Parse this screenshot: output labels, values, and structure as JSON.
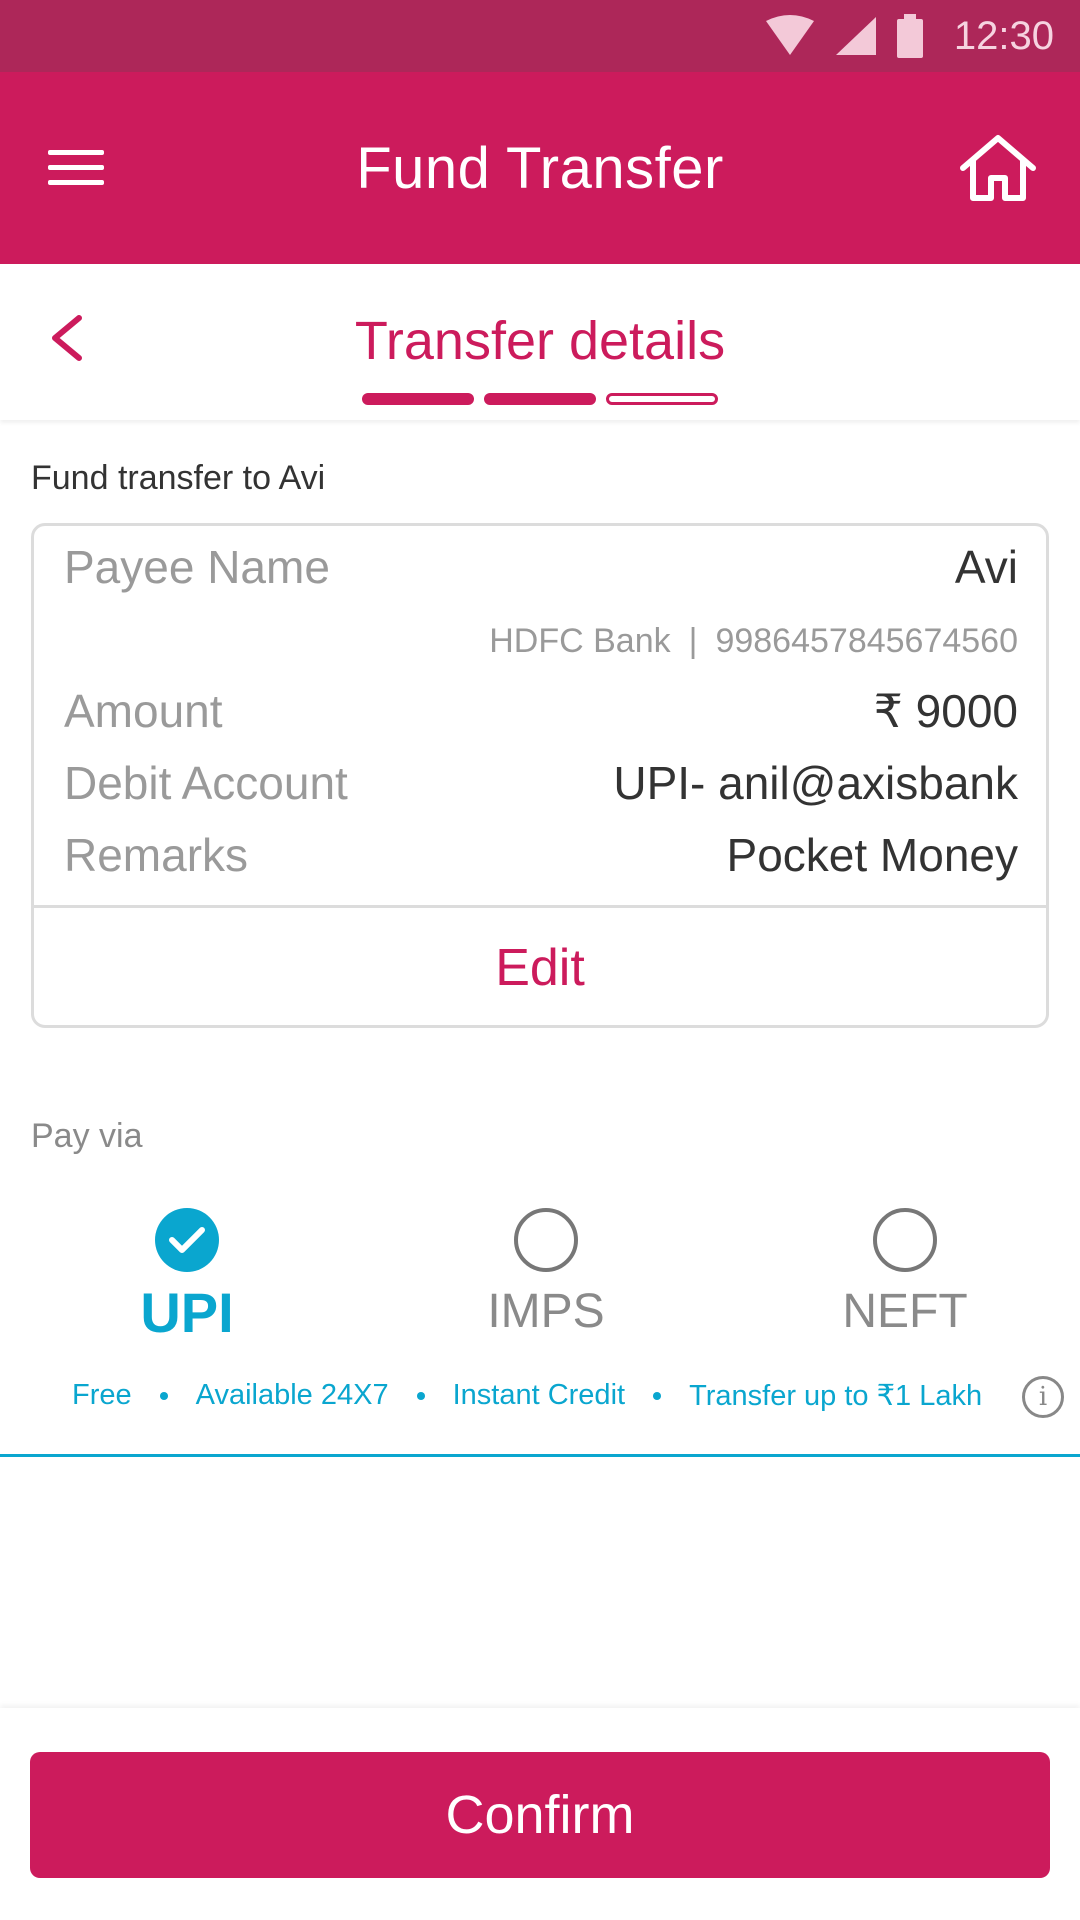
{
  "status_bar": {
    "time": "12:30"
  },
  "app_bar": {
    "title": "Fund Transfer"
  },
  "sub_header": {
    "title": "Transfer details",
    "steps_total": 3,
    "steps_completed": 2
  },
  "transfer_label": "Fund transfer to Avi",
  "details": {
    "payee_label": "Payee Name",
    "payee_value": "Avi",
    "bank_name": "HDFC Bank",
    "bank_separator": "|",
    "account_number": "9986457845674560",
    "amount_label": "Amount",
    "amount_value": "₹ 9000",
    "debit_label": "Debit Account",
    "debit_value": "UPI- anil@axisbank",
    "remarks_label": "Remarks",
    "remarks_value": "Pocket Money",
    "edit_label": "Edit"
  },
  "pay_via": {
    "label": "Pay via",
    "options": [
      {
        "label": "UPI",
        "selected": true
      },
      {
        "label": "IMPS",
        "selected": false
      },
      {
        "label": "NEFT",
        "selected": false
      }
    ],
    "features": [
      "Free",
      "Available 24X7",
      "Instant Credit",
      "Transfer up to ₹1 Lakh"
    ],
    "info_icon": "i"
  },
  "confirm_label": "Confirm",
  "colors": {
    "primary": "#cc1b5c",
    "status_bar": "#ad2759",
    "accent": "#0aa6cf"
  }
}
